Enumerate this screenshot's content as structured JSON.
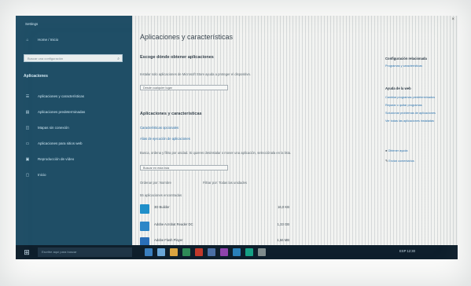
{
  "window": {
    "title": "Settings",
    "close_glyph": "×"
  },
  "sidebar": {
    "home_label": "Home / Inicio",
    "search_placeholder": "Buscar una configuración",
    "section_title": "Aplicaciones",
    "items": [
      {
        "icon": "apps-list-icon",
        "label": "Aplicaciones y características"
      },
      {
        "icon": "default-apps-icon",
        "label": "Aplicaciones predeterminadas"
      },
      {
        "icon": "offline-maps-icon",
        "label": "Mapas sin conexión"
      },
      {
        "icon": "websites-apps-icon",
        "label": "Aplicaciones para sitios web"
      },
      {
        "icon": "video-playback-icon",
        "label": "Reproducción de vídeo"
      },
      {
        "icon": "startup-icon",
        "label": "Inicio"
      }
    ]
  },
  "main": {
    "page_title": "Aplicaciones y características",
    "install_section": {
      "heading": "Escoge dónde obtener aplicaciones",
      "description": "Instalar solo aplicaciones de Microsoft Store ayuda a proteger el dispositivo.",
      "dropdown_value": "Desde cualquier lugar"
    },
    "apps_section": {
      "heading": "Aplicaciones y características",
      "links": [
        "Características opcionales",
        "Alias de ejecución de aplicaciones"
      ],
      "description": "Busca, ordena y filtra por unidad. Si quieres desinstalar o mover una aplicación, selecciónala en la lista.",
      "search_placeholder": "Buscar en esta lista",
      "sort_label": "Ordenar por: Nombre",
      "filter_label": "Filtrar por: Todas las unidades",
      "count_text": "55 aplicaciones encontradas",
      "apps": [
        {
          "name": "3D Builder",
          "size": "16,0 KB",
          "color": "#1f8fc9"
        },
        {
          "name": "Adobe Acrobat Reader DC",
          "size": "1,33 GB",
          "color": "#2d86c7"
        },
        {
          "name": "Adobe Flash Player",
          "size": "1,56 MB",
          "color": "#2a6fb8"
        }
      ]
    }
  },
  "right": {
    "related_heading": "Configuración relacionada",
    "related_links": [
      "Programas y características"
    ],
    "help_heading": "Ayuda de la web",
    "help_links": [
      "Cambiar programas predeterminados",
      "Reparar o quitar programas",
      "Solucionar problemas de aplicaciones",
      "Ver todas las aplicaciones instaladas"
    ],
    "get_help": "Obtener ayuda",
    "feedback": "Enviar comentarios"
  },
  "taskbar": {
    "search_placeholder": "Escribe aquí para buscar",
    "tray_text": "ESP   12:30",
    "icon_colors": [
      "#3a7fbf",
      "#6aa7d8",
      "#d9a441",
      "#2e8b57",
      "#c0392b",
      "#4a6fa5",
      "#8e44ad",
      "#2980b9",
      "#16a085",
      "#7f8c8d"
    ]
  }
}
